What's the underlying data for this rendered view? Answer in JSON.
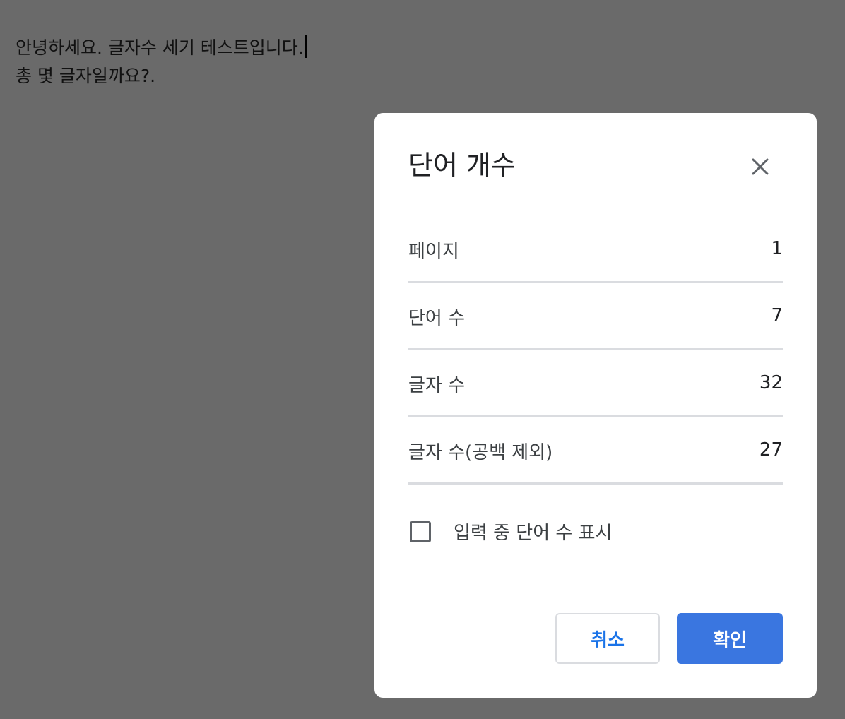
{
  "document": {
    "lines": [
      "안녕하세요. 글자수 세기 테스트입니다.",
      "총 몇 글자일까요?."
    ]
  },
  "dialog": {
    "title": "단어 개수",
    "close_icon": "close-icon",
    "stats": [
      {
        "label": "페이지",
        "value": "1"
      },
      {
        "label": "단어 수",
        "value": "7"
      },
      {
        "label": "글자 수",
        "value": "32"
      },
      {
        "label": "글자 수(공백 제외)",
        "value": "27"
      }
    ],
    "checkbox": {
      "label": "입력 중 단어 수 표시",
      "checked": false
    },
    "cancel_label": "취소",
    "ok_label": "확인"
  },
  "colors": {
    "overlay": "#6a6a6a",
    "primary": "#3a76e0",
    "link": "#1a73e8"
  }
}
